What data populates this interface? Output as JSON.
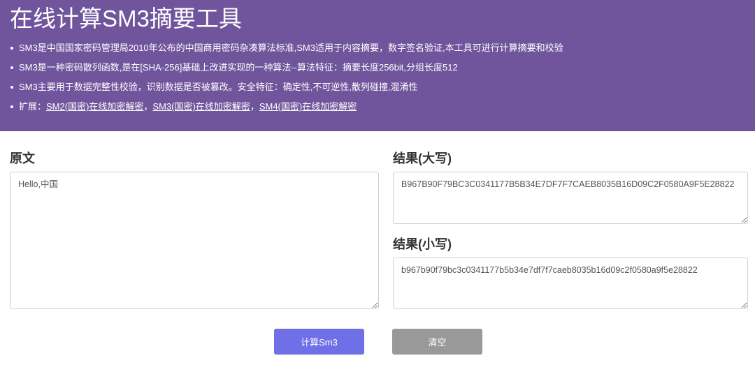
{
  "header": {
    "title": "在线计算SM3摘要工具",
    "bullets": [
      "SM3是中国国家密码管理局2010年公布的中国商用密码杂凑算法标准,SM3适用于内容摘要，数字签名验证,本工具可进行计算摘要和校验",
      "SM3是一种密码散列函数,是在[SHA-256]基础上改进实现的一种算法--算法特征：摘要长度256bit,分组长度512",
      "SM3主要用于数据完整性校验，识别数据是否被篡改。安全特征：确定性,不可逆性,散列碰撞,混淆性"
    ],
    "extension": {
      "prefix": "扩展：",
      "links": [
        "SM2(国密)在线加密解密",
        "SM3(国密)在线加密解密",
        "SM4(国密)在线加密解密"
      ],
      "separator": "，"
    }
  },
  "input": {
    "label": "原文",
    "value": "Hello,中国"
  },
  "result_upper": {
    "label": "结果(大写)",
    "value": "B967B90F79BC3C0341177B5B34E7DF7F7CAEB8035B16D09C2F0580A9F5E28822"
  },
  "result_lower": {
    "label": "结果(小写)",
    "value": "b967b90f79bc3c0341177b5b34e7df7f7caeb8035b16d09c2f0580a9f5e28822"
  },
  "buttons": {
    "calc_label": "计算Sm3",
    "clear_label": "清空"
  }
}
